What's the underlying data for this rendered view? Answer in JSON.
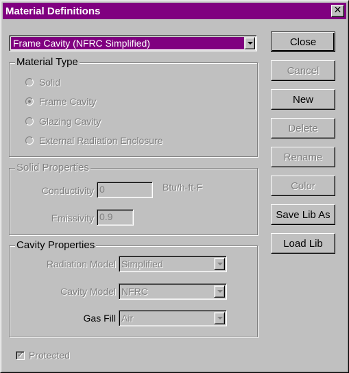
{
  "window": {
    "title": "Material Definitions",
    "close_glyph": "✕"
  },
  "material_select": {
    "value": "Frame Cavity (NFRC Simplified)"
  },
  "material_type": {
    "legend": "Material Type",
    "options": [
      "Solid",
      "Frame Cavity",
      "Glazing Cavity",
      "External Radiation Enclosure"
    ],
    "selected": "Frame Cavity"
  },
  "solid_properties": {
    "legend": "Solid Properties",
    "conductivity_label": "Conductivity",
    "conductivity_value": "0",
    "conductivity_unit": "Btu/h-ft-F",
    "emissivity_label": "Emissivity",
    "emissivity_value": "0.9"
  },
  "cavity_properties": {
    "legend": "Cavity Properties",
    "radiation_model_label": "Radiation Model",
    "radiation_model_value": "Simplified",
    "cavity_model_label": "Cavity Model",
    "cavity_model_value": "NFRC",
    "gas_fill_label": "Gas Fill",
    "gas_fill_value": "Air"
  },
  "protected": {
    "label": "Protected",
    "checked": true,
    "check_glyph": "✔"
  },
  "buttons": {
    "close": "Close",
    "cancel": "Cancel",
    "new": "New",
    "delete": "Delete",
    "rename": "Rename",
    "color": "Color",
    "save_lib_as": "Save Lib As",
    "load_lib": "Load Lib"
  },
  "colors": {
    "title_bar": "#800080",
    "face": "#c0c0c0",
    "selection": "#800080"
  }
}
